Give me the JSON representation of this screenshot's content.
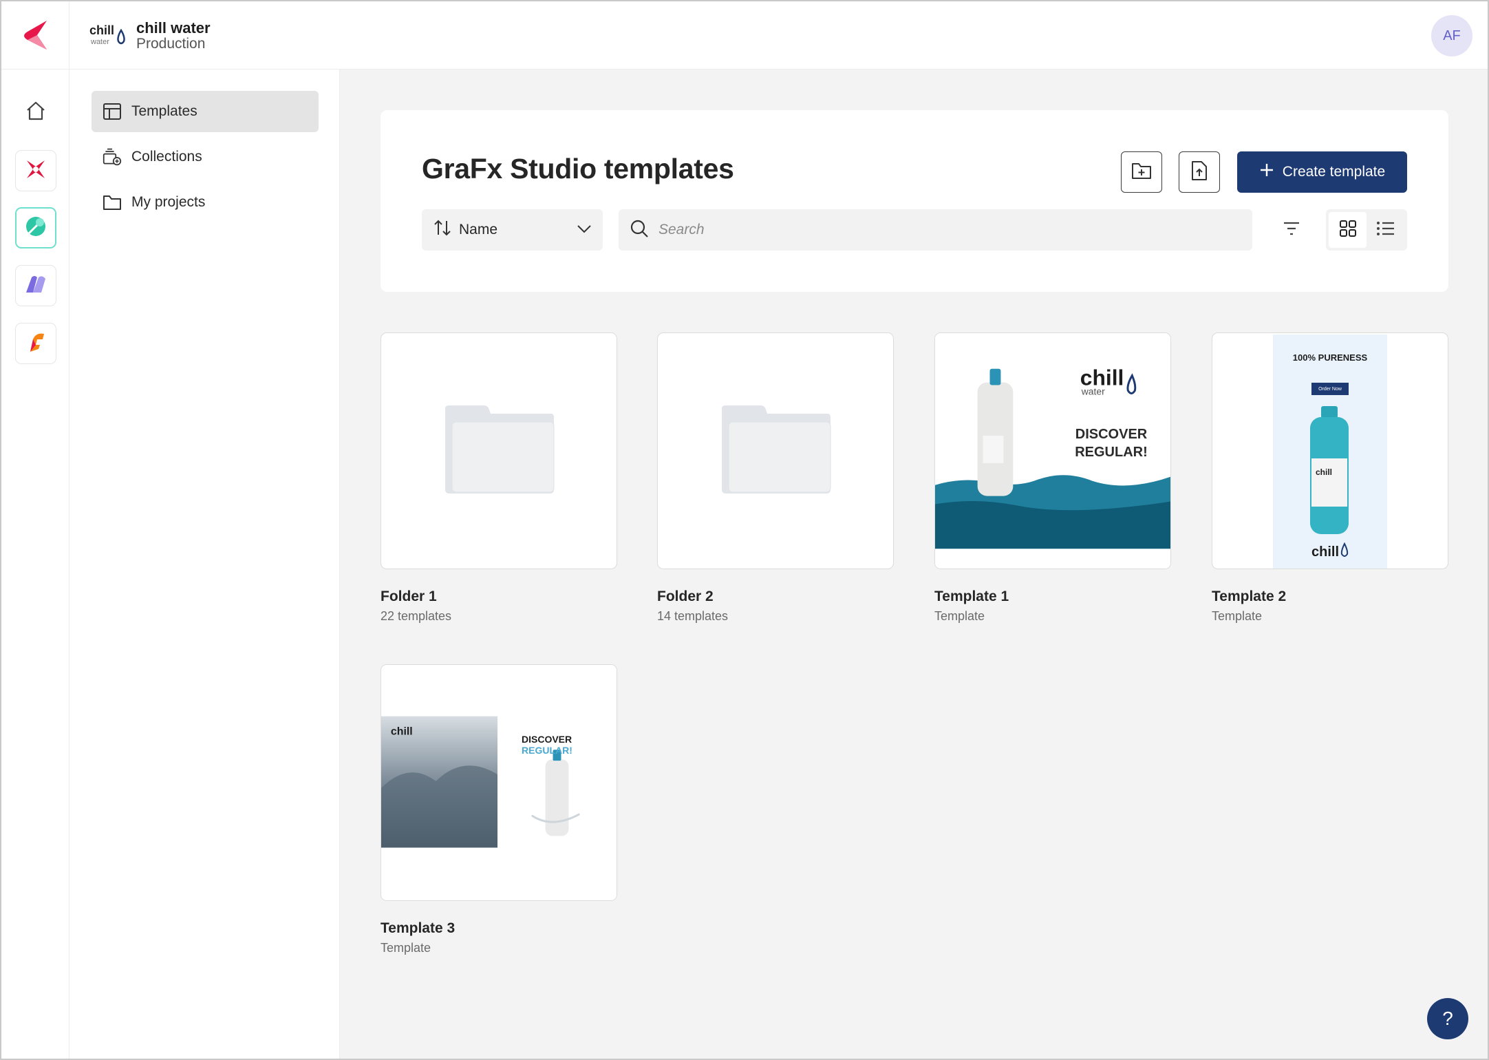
{
  "header": {
    "env_name": "chill water",
    "env_stage": "Production",
    "avatar_initials": "AF",
    "brand_logo_text": "chill water"
  },
  "rail": {
    "items": [
      {
        "name": "home",
        "icon": "home-icon"
      },
      {
        "name": "grafx-publisher",
        "icon": "star-burst-icon"
      },
      {
        "name": "grafx-studio",
        "icon": "leaf-icon"
      },
      {
        "name": "content-connector",
        "icon": "shape-icon"
      },
      {
        "name": "grafx-fonts",
        "icon": "flame-icon"
      }
    ]
  },
  "subnav": {
    "items": [
      {
        "label": "Templates",
        "icon": "template-icon",
        "active": true
      },
      {
        "label": "Collections",
        "icon": "collections-icon",
        "active": false
      },
      {
        "label": "My projects",
        "icon": "folder-icon",
        "active": false
      }
    ]
  },
  "page": {
    "title": "GraFx Studio templates",
    "create_label": "Create template",
    "sort_label": "Name",
    "search_placeholder": "Search"
  },
  "cards": [
    {
      "title": "Folder 1",
      "subtitle": "22 templates",
      "kind": "folder"
    },
    {
      "title": "Folder 2",
      "subtitle": "14 templates",
      "kind": "folder"
    },
    {
      "title": "Template 1",
      "subtitle": "Template",
      "kind": "template"
    },
    {
      "title": "Template 2",
      "subtitle": "Template",
      "kind": "template"
    },
    {
      "title": "Template 3",
      "subtitle": "Template",
      "kind": "template"
    }
  ],
  "thumbs": {
    "t1_text": "DISCOVER REGULAR!",
    "t1_logo": "chill water",
    "t2_headline": "100% PURENESS",
    "t2_button": "Order Now",
    "t2_logo": "chill water",
    "t3_text_a": "DISCOVER",
    "t3_text_b": "REGULAR!",
    "t3_logo": "chill water"
  },
  "help_label": "?",
  "colors": {
    "primary": "#1e3a72",
    "accent_teal": "#6fe0cd",
    "avatar_bg": "#e5e4f7",
    "brand_red": "#e8174a"
  }
}
